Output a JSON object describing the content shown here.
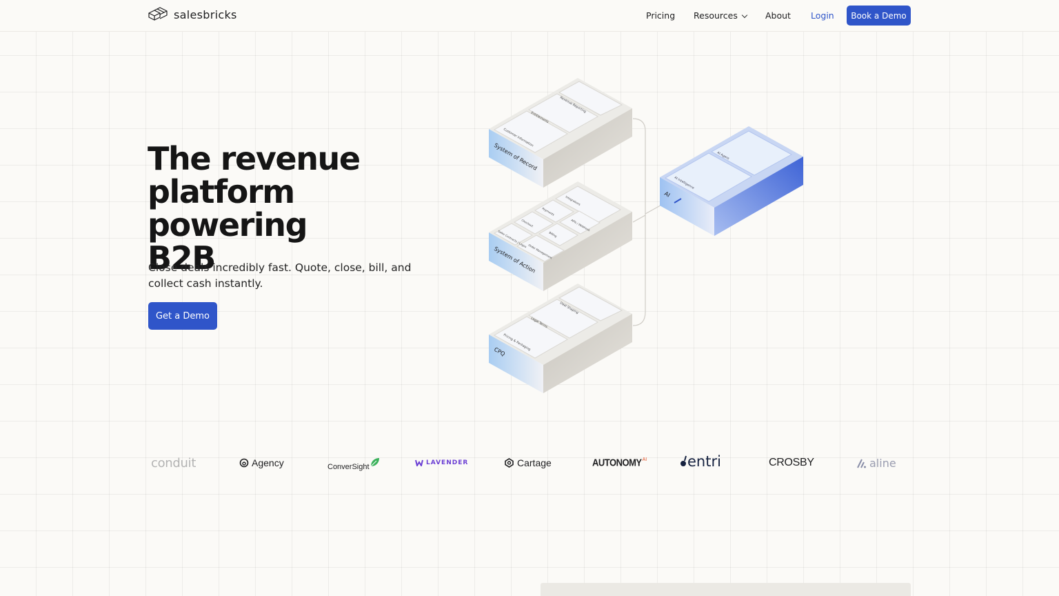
{
  "nav": {
    "brand": "salesbricks",
    "links": {
      "pricing": "Pricing",
      "resources": "Resources",
      "about": "About",
      "login": "Login"
    },
    "cta": "Book a Demo"
  },
  "hero": {
    "title_line1": "The revenue",
    "title_line2": "platform powering",
    "title_line3": "B2B",
    "subtitle": "Close deals incredibly fast. Quote, close, bill, and collect cash instantly.",
    "cta": "Get a Demo"
  },
  "diagram": {
    "record": {
      "label": "System of Record",
      "tiles": [
        "Customer Information",
        "Entitlements",
        "Revenue Reporting"
      ]
    },
    "action": {
      "label": "System of Action",
      "tiles": [
        "Sales Contracts / Logos",
        "Checkout",
        "Payments",
        "Integrations",
        "Order Management",
        "Billing",
        "APIs / Webhook"
      ]
    },
    "cpq": {
      "label": "CPQ",
      "tiles": [
        "Pricing & Packaging",
        "Legal Terms",
        "Deal Shaping"
      ]
    },
    "ai": {
      "label": "AI",
      "tiles": [
        "AI Intelligence",
        "AI Agent"
      ]
    }
  },
  "logos": {
    "conduit": "conduit",
    "agency": "Agency",
    "conversight": "ConverSight",
    "lavender": "LAVENDER",
    "cartage": "Cartage",
    "autonomy": "AUTONOMY",
    "autonomy_sup": "AI",
    "entri": "entri",
    "crosby": "CROSBY",
    "aline": "aline"
  },
  "colors": {
    "accent": "#2f55c9",
    "background": "#fbfaf7",
    "ai_block": "#5b7fe0"
  }
}
